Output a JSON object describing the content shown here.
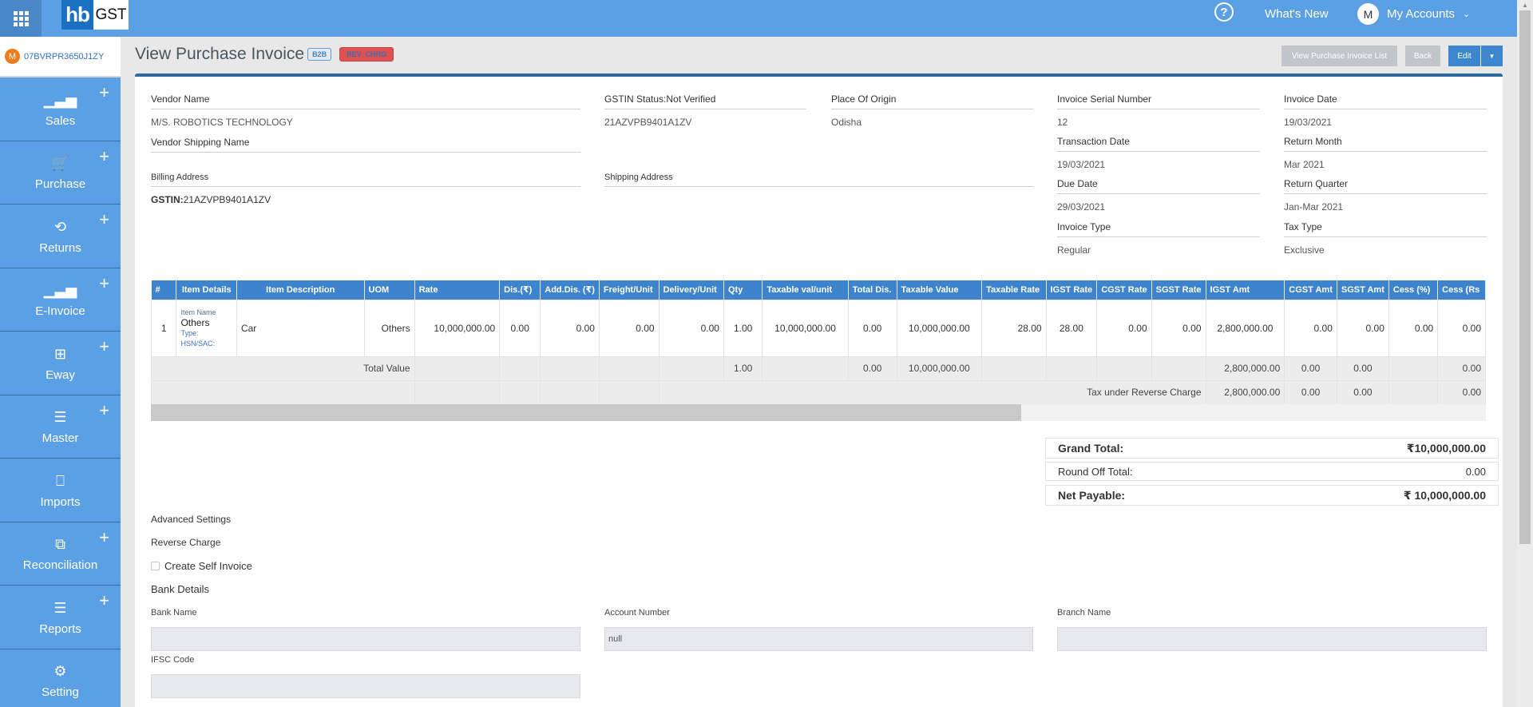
{
  "topbar": {
    "logo_hb": "hb",
    "logo_gst": "GST",
    "help_glyph": "?",
    "whats_new": "What's New",
    "avatar_letter": "M",
    "my_accounts": "My Accounts",
    "chevron": "⌄"
  },
  "sidebar": {
    "gstin_avatar": "M",
    "gstin": "07BVRPR3650J1ZY",
    "items": [
      {
        "label": "Sales",
        "icon": "bar-chart-icon",
        "glyph": "▁▃▅",
        "has_plus": true
      },
      {
        "label": "Purchase",
        "icon": "cart-icon",
        "glyph": "🛒",
        "has_plus": true
      },
      {
        "label": "Returns",
        "icon": "cycle-icon",
        "glyph": "⟲",
        "has_plus": true
      },
      {
        "label": "E-Invoice",
        "icon": "bar-chart-icon",
        "glyph": "▁▃▅",
        "has_plus": true
      },
      {
        "label": "Eway",
        "icon": "grid-icon",
        "glyph": "⊞",
        "has_plus": true
      },
      {
        "label": "Master",
        "icon": "menu-icon",
        "glyph": "☰",
        "has_plus": true
      },
      {
        "label": "Imports",
        "icon": "bookmark-icon",
        "glyph": "⎕",
        "has_plus": false
      },
      {
        "label": "Reconciliation",
        "icon": "copy-icon",
        "glyph": "⧉",
        "has_plus": true
      },
      {
        "label": "Reports",
        "icon": "menu-icon",
        "glyph": "☰",
        "has_plus": true
      },
      {
        "label": "Setting",
        "icon": "gear-icon",
        "glyph": "⚙",
        "has_plus": false
      }
    ],
    "plus_glyph": "+"
  },
  "header": {
    "title": "View Purchase Invoice",
    "badge_type": "B2B",
    "badge_rev": "REV_CHRG",
    "btn_list": "View Purchase Invoice List",
    "btn_back": "Back",
    "btn_edit": "Edit",
    "btn_caret": "▼"
  },
  "vendor": {
    "name_label": "Vendor Name",
    "name_value": "M/S. ROBOTICS TECHNOLOGY",
    "shipping_name_label": "Vendor Shipping Name",
    "billing_label": "Billing Address",
    "billing_gstin_prefix": "GSTIN:",
    "billing_gstin": "21AZVPB9401A1ZV",
    "gstin_status_label": "GSTIN Status:Not Verified",
    "gstin_value": "21AZVPB9401A1ZV",
    "shipping_address_label": "Shipping Address",
    "origin_label": "Place Of Origin",
    "origin_value": "Odisha"
  },
  "invoice": {
    "serial_label": "Invoice Serial Number",
    "serial_value": "12",
    "date_label": "Invoice Date",
    "date_value": "19/03/2021",
    "txn_label": "Transaction Date",
    "txn_value": "19/03/2021",
    "return_month_label": "Return Month",
    "return_month_value": "Mar 2021",
    "due_label": "Due Date",
    "due_value": "29/03/2021",
    "return_quarter_label": "Return Quarter",
    "return_quarter_value": "Jan-Mar 2021",
    "type_label": "Invoice Type",
    "type_value": "Regular",
    "tax_type_label": "Tax Type",
    "tax_type_value": "Exclusive"
  },
  "table": {
    "headers": [
      "#",
      "Item Details",
      "Item Description",
      "UOM",
      "Rate",
      "Dis.(₹)",
      "Add.Dis. (₹)",
      "Freight/Unit",
      "Delivery/Unit",
      "Qty",
      "Taxable val/unit",
      "Total Dis.",
      "Taxable Value",
      "Taxable Rate",
      "IGST Rate",
      "CGST Rate",
      "SGST Rate",
      "IGST Amt",
      "CGST Amt",
      "SGST Amt",
      "Cess (%)",
      "Cess (Rs"
    ],
    "row": {
      "num": "1",
      "item_name_label": "Item Name",
      "item_name": "Others",
      "type_label": "Type:",
      "hsn_label": "HSN/SAC:",
      "description": "Car",
      "uom": "Others",
      "rate": "10,000,000.00",
      "dis": "0.00",
      "add_dis": "0.00",
      "freight": "0.00",
      "delivery": "0.00",
      "qty": "1.00",
      "taxable_unit": "10,000,000.00",
      "total_dis": "0.00",
      "taxable_value": "10,000,000.00",
      "taxable_rate": "28.00",
      "igst_rate": "28.00",
      "cgst_rate": "0.00",
      "sgst_rate": "0.00",
      "igst_amt": "2,800,000.00",
      "cgst_amt": "0.00",
      "sgst_amt": "0.00",
      "cess_pct": "0.00",
      "cess_rs": "0.00"
    },
    "total_row": {
      "label": "Total Value",
      "qty": "1.00",
      "total_dis": "0.00",
      "taxable_value": "10,000,000.00",
      "igst_amt": "2,800,000.00",
      "cgst_amt": "0.00",
      "sgst_amt": "0.00",
      "cess_rs": "0.00"
    },
    "rc_row": {
      "label": "Tax under Reverse Charge",
      "igst_amt": "2,800,000.00",
      "cgst_amt": "0.00",
      "sgst_amt": "0.00",
      "cess_rs": "0.00"
    }
  },
  "totals": {
    "grand_label": "Grand Total:",
    "grand_value": "₹10,000,000.00",
    "round_label": "Round Off Total:",
    "round_value": "0.00",
    "net_label": "Net Payable:",
    "net_value": "₹ 10,000,000.00"
  },
  "advanced": {
    "title": "Advanced Settings",
    "reverse_charge": "Reverse Charge",
    "self_invoice": "Create Self Invoice",
    "self_invoice_checked": false,
    "bank_title": "Bank Details",
    "bank_name_label": "Bank Name",
    "bank_name_value": "",
    "account_label": "Account Number",
    "account_value": "null",
    "branch_label": "Branch Name",
    "branch_value": "",
    "ifsc_label": "IFSC Code",
    "ifsc_value": ""
  }
}
